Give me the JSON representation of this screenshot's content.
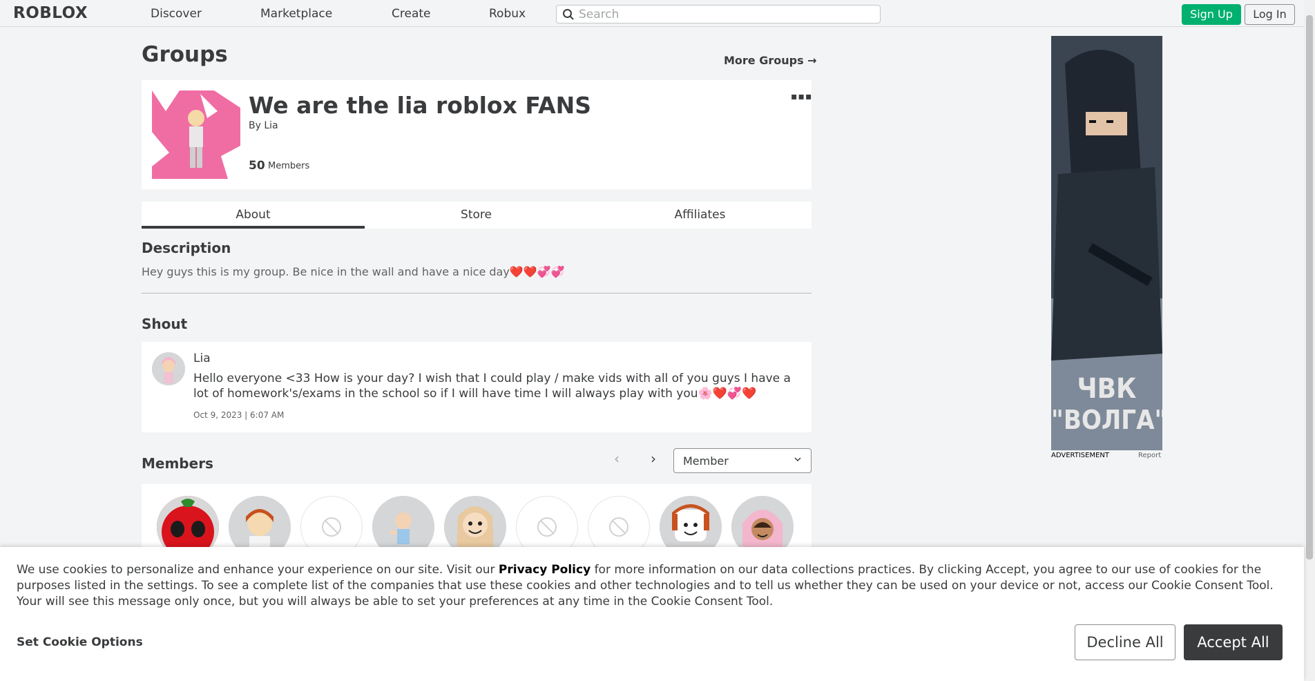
{
  "nav": {
    "logo": "ROBLOX",
    "links": [
      "Discover",
      "Marketplace",
      "Create",
      "Robux"
    ],
    "search_placeholder": "Search",
    "signup": "Sign Up",
    "login": "Log In"
  },
  "page": {
    "title": "Groups",
    "more_groups": "More Groups →"
  },
  "group": {
    "name": "We are the lia roblox FANS",
    "owner": "By Lia",
    "member_count": "50",
    "member_label": "Members",
    "menu_icon": "more-dots-icon"
  },
  "tabs": [
    "About",
    "Store",
    "Affiliates"
  ],
  "active_tab": "About",
  "description": {
    "heading": "Description",
    "text": "Hey guys this is my group. Be nice in the wall and have a nice day❤️❤️💞💞"
  },
  "shout": {
    "heading": "Shout",
    "user": "Lia",
    "body": "Hello everyone <33 How is your day? I wish that I could play / make vids with all of you guys I have a lot of homework's/exams in the school so if I will have time I will always play with you🌸❤️💞❤️",
    "date": "Oct 9, 2023 | 6:07 AM"
  },
  "members": {
    "heading": "Members",
    "role_selected": "Member",
    "avatars": [
      "red-character",
      "girl-orange-hair",
      "unavailable",
      "baby-character",
      "blonde-smile",
      "unavailable",
      "unavailable",
      "bacon-orange-hair",
      "pink-hood-girl"
    ]
  },
  "ad": {
    "title_line1": "ЧВК",
    "title_line2": "\"ВОЛГА\"",
    "caption": "ADVERTISEMENT",
    "report": "Report"
  },
  "cookie": {
    "text_before": "We use cookies to personalize and enhance your experience on our site. Visit our ",
    "link": "Privacy Policy",
    "text_after": " for more information on our data collections practices. By clicking Accept, you agree to our use of cookies for the purposes listed in the settings. To see a complete list of the companies that use these cookies and other technologies and to tell us whether they can be used on your device or not, access our Cookie Consent Tool. Your will see this message only once, but you will always be able to set your preferences at any time in the Cookie Consent Tool.",
    "options": "Set Cookie Options",
    "decline": "Decline All",
    "accept": "Accept All"
  },
  "colors": {
    "signup_green": "#00b06f",
    "accept_dark": "#393b3d",
    "group_pink": "#f06da4"
  }
}
